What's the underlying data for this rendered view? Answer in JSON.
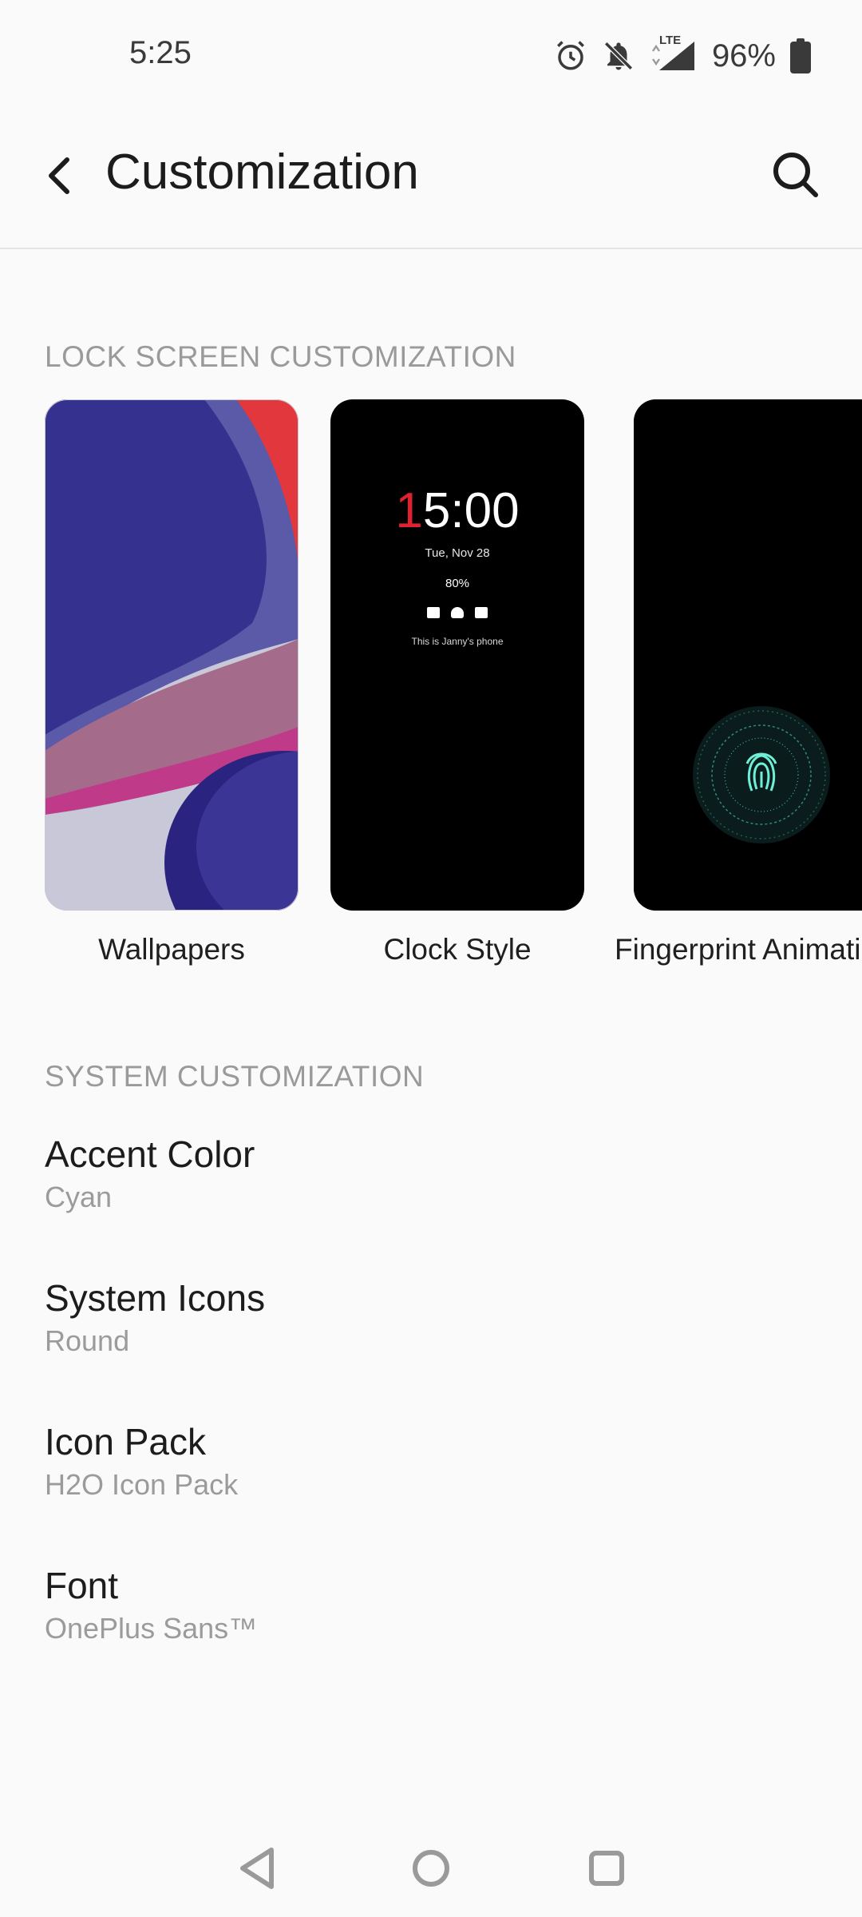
{
  "status_bar": {
    "time": "5:25",
    "battery_percent": "96%",
    "network_label": "LTE",
    "icons": [
      "alarm-icon",
      "notifications-off-icon",
      "signal-icon",
      "battery-icon"
    ]
  },
  "toolbar": {
    "title": "Customization",
    "back_icon": "back-arrow-icon",
    "search_icon": "search-icon"
  },
  "lock_screen": {
    "header": "LOCK SCREEN CUSTOMIZATION",
    "cards": [
      {
        "label": "Wallpapers"
      },
      {
        "label": "Clock Style",
        "preview": {
          "time_accent": "1",
          "time_rest": "5:00",
          "date": "Tue, Nov 28",
          "battery": "80%",
          "owner": "This is Janny's phone"
        }
      },
      {
        "label": "Fingerprint Animation"
      }
    ]
  },
  "system": {
    "header": "SYSTEM CUSTOMIZATION",
    "items": [
      {
        "title": "Accent Color",
        "value": "Cyan"
      },
      {
        "title": "System Icons",
        "value": "Round"
      },
      {
        "title": "Icon Pack",
        "value": "H2O Icon Pack"
      },
      {
        "title": "Font",
        "value": "OnePlus Sans™"
      }
    ]
  },
  "colors": {
    "background": "#fafafa",
    "accent_red": "#e0212f",
    "fingerprint_cyan": "#3fd6c0"
  },
  "nav_bar": {
    "icons": [
      "nav-back-icon",
      "nav-home-icon",
      "nav-recents-icon"
    ]
  }
}
